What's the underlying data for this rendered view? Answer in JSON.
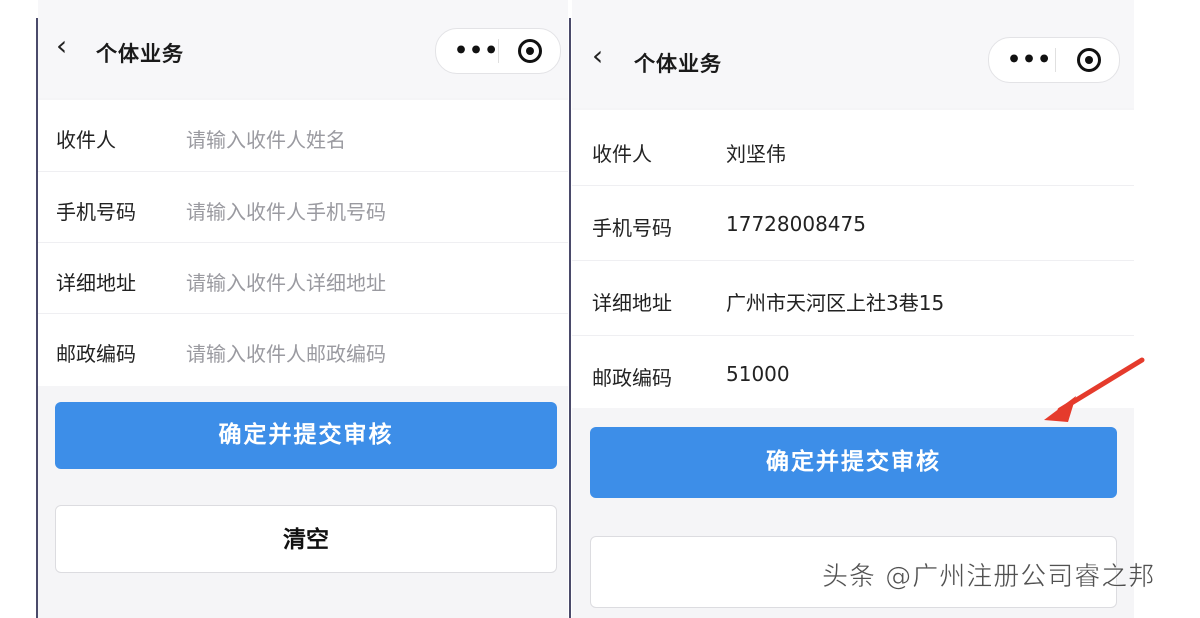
{
  "screens": [
    {
      "nav": {
        "back_icon": "‹",
        "title": "个体业务",
        "more_icon": "•••",
        "target_icon": "record-icon"
      },
      "fields": [
        {
          "label": "收件人",
          "placeholder": "请输入收件人姓名",
          "value": ""
        },
        {
          "label": "手机号码",
          "placeholder": "请输入收件人手机号码",
          "value": ""
        },
        {
          "label": "详细地址",
          "placeholder": "请输入收件人详细地址",
          "value": ""
        },
        {
          "label": "邮政编码",
          "placeholder": "请输入收件人邮政编码",
          "value": ""
        }
      ],
      "submit_label": "确定并提交审核",
      "clear_label": "清空"
    },
    {
      "nav": {
        "back_icon": "‹",
        "title": "个体业务",
        "more_icon": "•••",
        "target_icon": "record-icon"
      },
      "fields": [
        {
          "label": "收件人",
          "value": "刘坚伟"
        },
        {
          "label": "手机号码",
          "value": "17728008475"
        },
        {
          "label": "详细地址",
          "value": "广州市天河区上社3巷15"
        },
        {
          "label": "邮政编码",
          "value": "51000"
        }
      ],
      "submit_label": "确定并提交审核",
      "clear_label": ""
    }
  ],
  "annotation": {
    "arrow_color": "#e53b2c"
  },
  "watermark": {
    "text": "头条 @广州注册公司睿之邦"
  },
  "colors": {
    "primary": "#3d8ee8",
    "background": "#f5f5f7"
  }
}
